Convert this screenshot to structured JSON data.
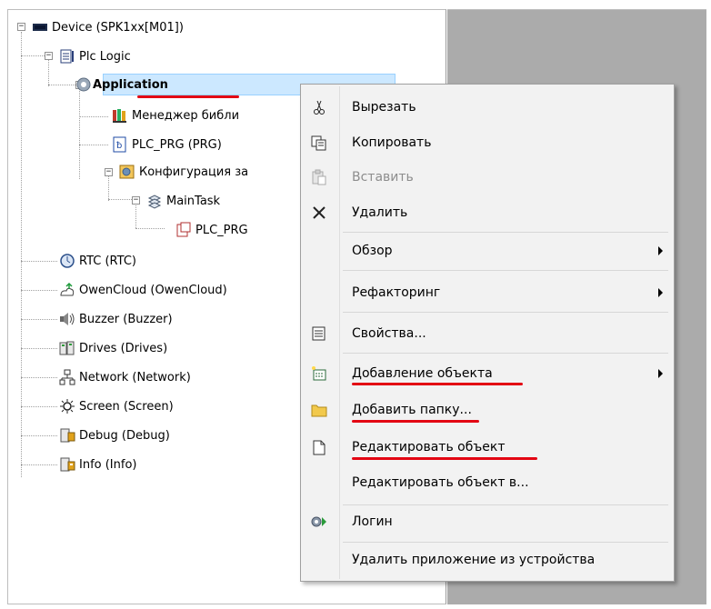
{
  "tree": {
    "device": "Device (SPK1xx[M01])",
    "plc_logic": "Plc Logic",
    "application": "Application",
    "library_manager": "Менеджер библи",
    "plc_prg": "PLC_PRG (PRG)",
    "task_config": "Конфигурация за",
    "main_task": "MainTask",
    "main_task_prg": "PLC_PRG",
    "rtc": "RTC (RTC)",
    "owencloud": "OwenCloud (OwenCloud)",
    "buzzer": "Buzzer (Buzzer)",
    "drives": "Drives (Drives)",
    "network": "Network (Network)",
    "screen": "Screen (Screen)",
    "debug": "Debug (Debug)",
    "info": "Info (Info)",
    "expander_minus": "−"
  },
  "context_menu": {
    "cut": "Вырезать",
    "copy": "Копировать",
    "paste": "Вставить",
    "delete": "Удалить",
    "browse": "Обзор",
    "refactoring": "Рефакторинг",
    "properties": "Свойства...",
    "add_object": "Добавление объекта",
    "add_folder": "Добавить папку...",
    "edit_object": "Редактировать объект",
    "edit_object_with": "Редактировать объект в...",
    "login": "Логин",
    "remove_app": "Удалить приложение из устройства"
  },
  "colors": {
    "highlight_underline": "#e30613",
    "selection_bg": "#cce8ff",
    "menu_bg": "#f2f2f2",
    "side_panel": "#ababab"
  }
}
